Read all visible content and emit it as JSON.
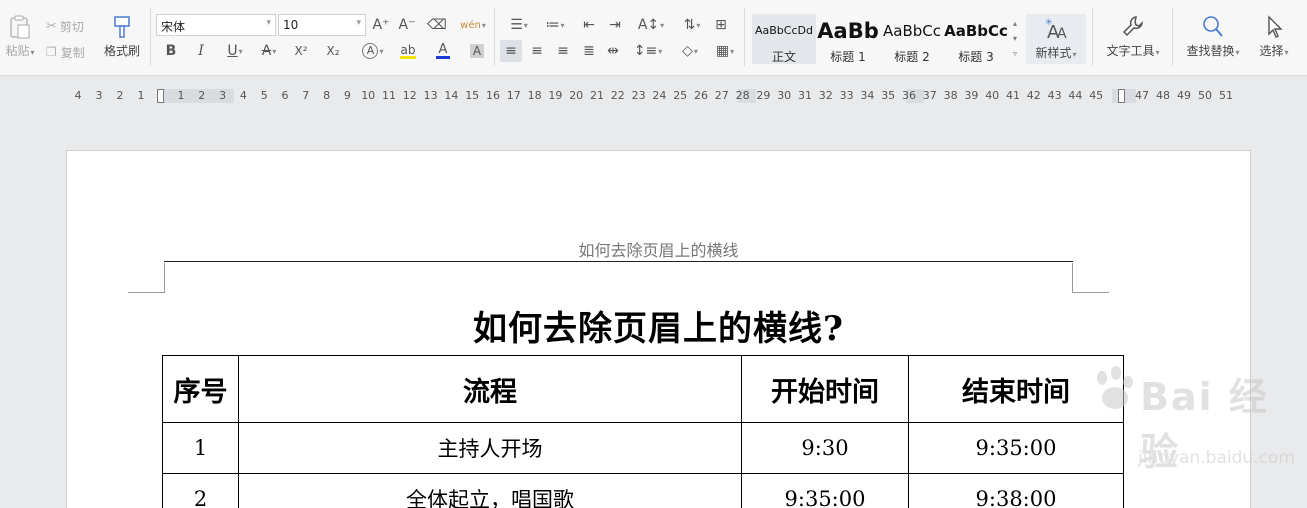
{
  "toolbar": {
    "paste_label": "粘贴",
    "cut_label": "剪切",
    "copy_label": "复制",
    "format_painter_label": "格式刷",
    "font_name": "宋体",
    "font_size": "10",
    "bold_glyph": "B",
    "italic_glyph": "I",
    "underline_glyph": "U",
    "strike_glyph": "A",
    "superscript_glyph": "X²",
    "subscript_glyph": "X₂",
    "text_effect_glyph": "A",
    "highlight_glyph": "ab",
    "font_color_glyph": "A",
    "char_shading_glyph": "A",
    "grow_font_glyph": "A⁺",
    "shrink_font_glyph": "A⁻",
    "phonetic_glyph": "wén",
    "styles": [
      {
        "sample": "AaBbCcDd",
        "name": "正文"
      },
      {
        "sample": "AaBb",
        "name": "标题 1"
      },
      {
        "sample": "AaBbCc",
        "name": "标题 2"
      },
      {
        "sample": "AaBbCc",
        "name": "标题 3"
      }
    ],
    "new_style_label": "新样式",
    "text_tools_label": "文字工具",
    "find_replace_label": "查找替换",
    "select_label": "选择",
    "colors": {
      "highlight": "#f5e400",
      "font_color": "#1a3bd6",
      "accent": "#4a7bd0"
    }
  },
  "ruler": {
    "left_numbers": [
      "4",
      "3",
      "2",
      "1"
    ],
    "numbers": [
      "1",
      "2",
      "3",
      "4",
      "5",
      "6",
      "7",
      "8",
      "9",
      "10",
      "11",
      "12",
      "13",
      "14",
      "15",
      "16",
      "17",
      "18",
      "19",
      "20",
      "21",
      "22",
      "23",
      "24",
      "25",
      "26",
      "27",
      "28",
      "29",
      "30",
      "31",
      "32",
      "33",
      "34",
      "35",
      "36",
      "37",
      "38",
      "39",
      "40",
      "41",
      "42",
      "43",
      "44",
      "45"
    ],
    "right_numbers": [
      "47",
      "48",
      "49",
      "50",
      "51"
    ]
  },
  "document": {
    "header_text": "如何去除页眉上的横线",
    "title": "如何去除页眉上的横线?",
    "table": {
      "headers": [
        "序号",
        "流程",
        "开始时间",
        "结束时间"
      ],
      "rows": [
        [
          "1",
          "主持人开场",
          "9:30",
          "9:35:00"
        ],
        [
          "2",
          "全体起立，唱国歌",
          "9:35:00",
          "9:38:00"
        ]
      ]
    }
  },
  "watermark": {
    "brand": "Bai 经验",
    "url": "jingyan.baidu.com"
  }
}
